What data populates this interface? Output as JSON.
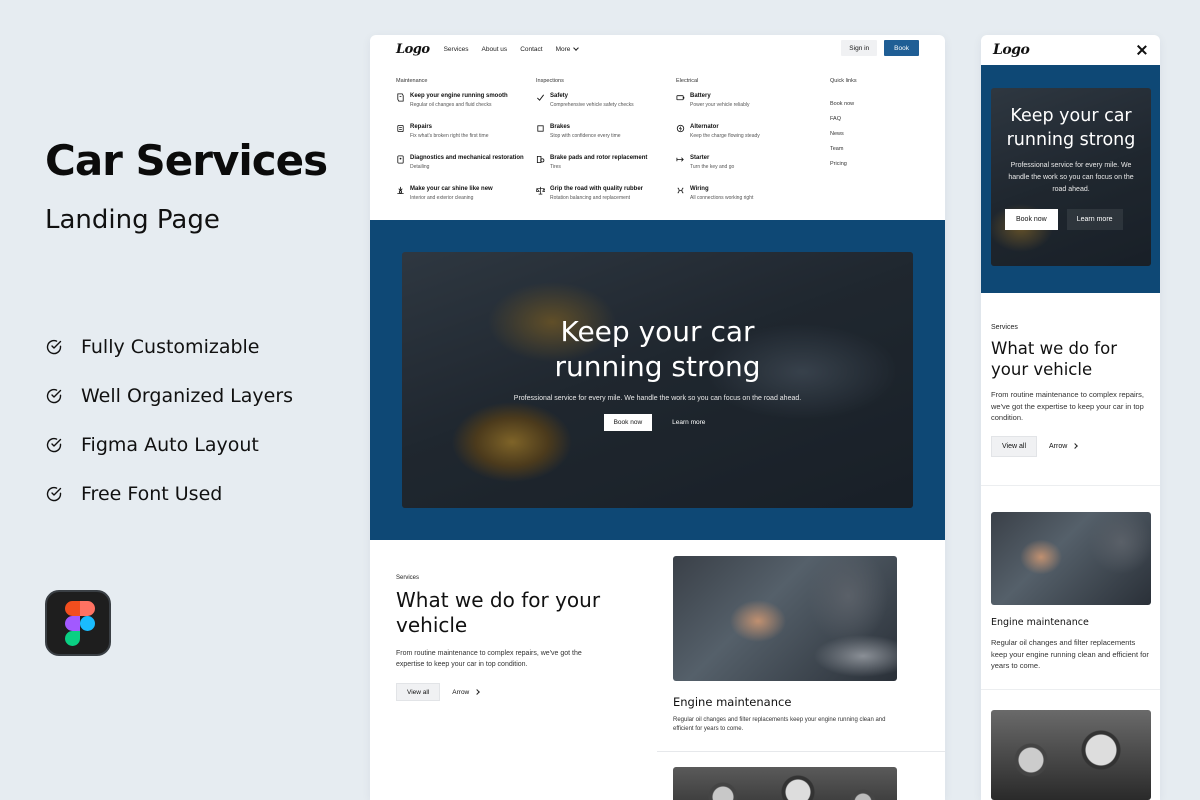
{
  "promo": {
    "title": "Car Services",
    "subtitle": "Landing Page",
    "features": [
      "Fully Customizable",
      "Well Organized Layers",
      "Figma Auto Layout",
      "Free Font Used"
    ]
  },
  "desktop": {
    "logo": "Logo",
    "nav_links": [
      "Services",
      "About us",
      "Contact",
      "More"
    ],
    "signin_label": "Sign in",
    "book_label": "Book",
    "menu": {
      "columns": [
        {
          "heading": "Maintenance",
          "items": [
            {
              "title": "Keep your engine running smooth",
              "desc": "Regular oil changes and fluid checks",
              "icon": "engine-icon"
            },
            {
              "title": "Repairs",
              "desc": "Fix what's broken right the first time",
              "icon": "repair-icon"
            },
            {
              "title": "Diagnostics and mechanical restoration",
              "desc": "Detailing",
              "icon": "diagnostics-icon"
            },
            {
              "title": "Make your car shine like new",
              "desc": "Interior and exterior cleaning",
              "icon": "shine-icon"
            }
          ]
        },
        {
          "heading": "Inspections",
          "items": [
            {
              "title": "Safety",
              "desc": "Comprehensive vehicle safety checks",
              "icon": "check-icon"
            },
            {
              "title": "Brakes",
              "desc": "Stop with confidence every time",
              "icon": "brake-icon"
            },
            {
              "title": "Brake pads and rotor replacement",
              "desc": "Tires",
              "icon": "rotor-icon"
            },
            {
              "title": "Grip the road with quality rubber",
              "desc": "Rotation balancing and replacement",
              "icon": "balance-icon"
            }
          ]
        },
        {
          "heading": "Electrical",
          "items": [
            {
              "title": "Battery",
              "desc": "Power your vehicle reliably",
              "icon": "battery-icon"
            },
            {
              "title": "Alternator",
              "desc": "Keep the charge flowing steady",
              "icon": "alternator-icon"
            },
            {
              "title": "Starter",
              "desc": "Turn the key and go",
              "icon": "starter-icon"
            },
            {
              "title": "Wiring",
              "desc": "All connections working right",
              "icon": "wiring-icon"
            }
          ]
        }
      ],
      "quick_links": {
        "heading": "Quick links",
        "items": [
          "Book now",
          "FAQ",
          "News",
          "Team",
          "Pricing"
        ]
      }
    },
    "hero": {
      "title_line1": "Keep your car",
      "title_line2": "running strong",
      "desc": "Professional service for every mile. We handle the work so you can focus on the road ahead.",
      "primary_label": "Book now",
      "secondary_label": "Learn more"
    },
    "services": {
      "eyebrow": "Services",
      "title": "What we do for your vehicle",
      "desc": "From routine maintenance to complex repairs, we've got the expertise to keep your car in top condition.",
      "view_all": "View all",
      "arrow": "Arrow"
    },
    "card": {
      "title": "Engine maintenance",
      "desc": "Regular oil changes and filter replacements keep your engine running clean and efficient for years to come."
    }
  },
  "mobile": {
    "logo": "Logo",
    "hero": {
      "title": "Keep your car running strong",
      "desc": "Professional service for every mile. We handle the work so you can focus on the road ahead.",
      "primary_label": "Book now",
      "secondary_label": "Learn more"
    },
    "services": {
      "eyebrow": "Services",
      "title": "What we do for your vehicle",
      "desc": "From routine maintenance to complex repairs, we've got the expertise to keep your car in top condition.",
      "view_all": "View all",
      "arrow": "Arrow"
    },
    "card": {
      "title": "Engine maintenance",
      "desc": "Regular oil changes and filter replacements keep your engine running clean and efficient for years to come."
    }
  },
  "colors": {
    "background": "#e6ecf1",
    "brand_blue": "#0e4875",
    "button_blue": "#1f5e95"
  }
}
